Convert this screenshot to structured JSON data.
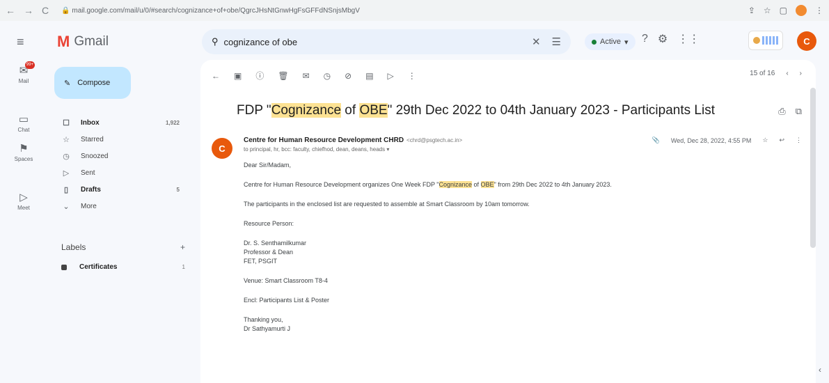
{
  "browser": {
    "url": "mail.google.com/mail/u/0/#search/cognizance+of+obe/QgrcJHsNtGnwHgFsGFFdNSnjsMbgV"
  },
  "app": {
    "name": "Gmail"
  },
  "search": {
    "query": "cognizance of obe"
  },
  "status": {
    "label": "Active"
  },
  "user": {
    "avatar_letter": "C"
  },
  "rail": [
    {
      "label": "Mail",
      "icon": "mail-icon",
      "badge": "99+"
    },
    {
      "label": "Chat",
      "icon": "chat-icon"
    },
    {
      "label": "Spaces",
      "icon": "spaces-icon"
    },
    {
      "label": "Meet",
      "icon": "meet-icon"
    }
  ],
  "sidebar": {
    "compose_label": "Compose",
    "items": [
      {
        "label": "Inbox",
        "count": "1,922",
        "icon": "inbox-icon",
        "bold": true
      },
      {
        "label": "Starred",
        "count": "",
        "icon": "star-icon",
        "bold": false
      },
      {
        "label": "Snoozed",
        "count": "",
        "icon": "clock-icon",
        "bold": false
      },
      {
        "label": "Sent",
        "count": "",
        "icon": "send-icon",
        "bold": false
      },
      {
        "label": "Drafts",
        "count": "5",
        "icon": "draft-icon",
        "bold": true
      },
      {
        "label": "More",
        "count": "",
        "icon": "chevron-down-icon",
        "bold": false
      }
    ],
    "labels_heading": "Labels",
    "labels": [
      {
        "label": "Certificates",
        "count": "1"
      }
    ]
  },
  "email": {
    "pager": "15 of 16",
    "subject_parts": [
      "FDP \"",
      "Cognizance",
      " of ",
      "OBE",
      "\" 29th Dec 2022 to 04th January 2023 - Participants List"
    ],
    "sender_name": "Centre for Human Resource Development CHRD",
    "sender_email": "<chrd@psgtech.ac.in>",
    "recipients": "to principal, hr, bcc: faculty, chiefhod, dean, deans, heads ▾",
    "date": "Wed, Dec 28, 2022, 4:55 PM",
    "greeting": "Dear Sir/Madam,",
    "line1_parts": [
      "Centre for Human Resource Development organizes One Week FDP \"",
      "Cognizance",
      " of ",
      "OBE",
      "\" from 29th Dec 2022 to 4th January 2023."
    ],
    "line2": "The participants in the enclosed list are requested to assemble at Smart Classroom by 10am tomorrow.",
    "resource_heading": "Resource Person:",
    "sig_name": "Dr. S. Senthamilkumar",
    "sig_title": "Professor & Dean",
    "sig_org": "FET, PSGIT",
    "venue": "Venue: Smart Classroom T8-4",
    "enclosure": "Encl: Participants List & Poster",
    "closing": "Thanking you,",
    "closing_name": "Dr Sathyamurti J"
  }
}
